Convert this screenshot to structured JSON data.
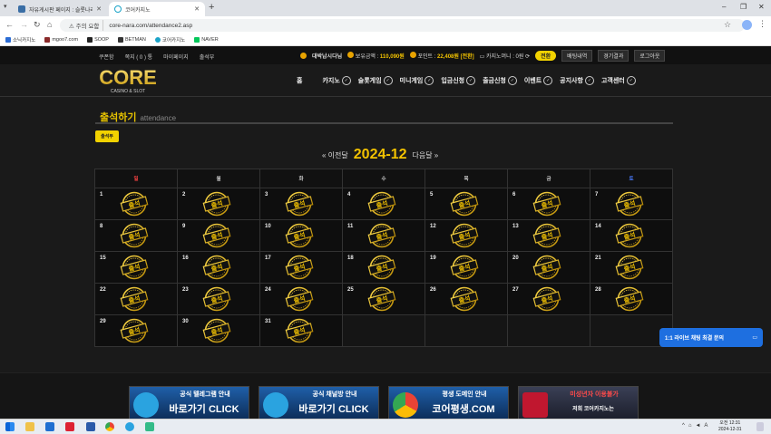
{
  "browser": {
    "tabs": [
      {
        "title": "자유게시판 페이지 : 슬롯나라",
        "active": false
      },
      {
        "title": "코어카지노",
        "active": true
      }
    ],
    "security_label": "주의 요함",
    "url": "core-nara.com/attendance2.asp",
    "bookmarks": [
      "소닉카지노",
      "mgoo7.com",
      "SOOP",
      "BETMAN",
      "코어카지노",
      "NAVER"
    ]
  },
  "site": {
    "top_links": [
      "쿠폰함",
      "쪽지 ( 0 ) 통",
      "마이페이지",
      "출석부"
    ],
    "user": {
      "nickname": "대박납시다님",
      "balance_label": "보유금액 :",
      "balance": "110,090원",
      "points_label": "포인트 :",
      "points": "22,408원 [전환]",
      "casino_label": "카지노머니 : 0원",
      "convert_label": "전환",
      "bet_history": "배팅내역",
      "results": "경기결과",
      "logout": "로그아웃"
    },
    "logo": {
      "main": "CORE",
      "sub": "CASINO & SLOT"
    },
    "nav": [
      "홈",
      "카지노",
      "슬롯게임",
      "미니게임",
      "입금신청",
      "출금신청",
      "이벤트",
      "공지사항",
      "고객센터"
    ],
    "page_title": "출석하기",
    "page_title_en": "attendance",
    "attend_button": "출석부",
    "month_prev": "« 이전달",
    "month": "2024-12",
    "month_next": "다음달 »",
    "weekdays": [
      "일",
      "월",
      "화",
      "수",
      "목",
      "금",
      "토"
    ],
    "stamp_text": "출석",
    "calendar_rows": [
      [
        "1",
        "2",
        "3",
        "4",
        "5",
        "6",
        "7"
      ],
      [
        "8",
        "9",
        "10",
        "11",
        "12",
        "13",
        "14"
      ],
      [
        "15",
        "16",
        "17",
        "18",
        "19",
        "20",
        "21"
      ],
      [
        "22",
        "23",
        "24",
        "25",
        "26",
        "27",
        "28"
      ],
      [
        "29",
        "30",
        "31",
        "",
        "",
        "",
        ""
      ]
    ],
    "banners": [
      {
        "title": "공식 텔레그램 안내",
        "cta": "바로가기 CLICK"
      },
      {
        "title": "공식 채널방 안내",
        "cta": "바로가기 CLICK"
      },
      {
        "title": "평생 도메인 안내",
        "cta": "코어평생.COM"
      },
      {
        "title": "미성년자 이용불가",
        "cta": "저희 코어카지노는"
      }
    ],
    "chat_label": "1:1 라이브 채팅 최결 문의"
  },
  "taskbar": {
    "time": "오전 12:31",
    "date": "2024-12-31"
  },
  "colors": {
    "accent": "#f2c200",
    "background": "#1a1a1a",
    "chat": "#1e6fe0"
  }
}
